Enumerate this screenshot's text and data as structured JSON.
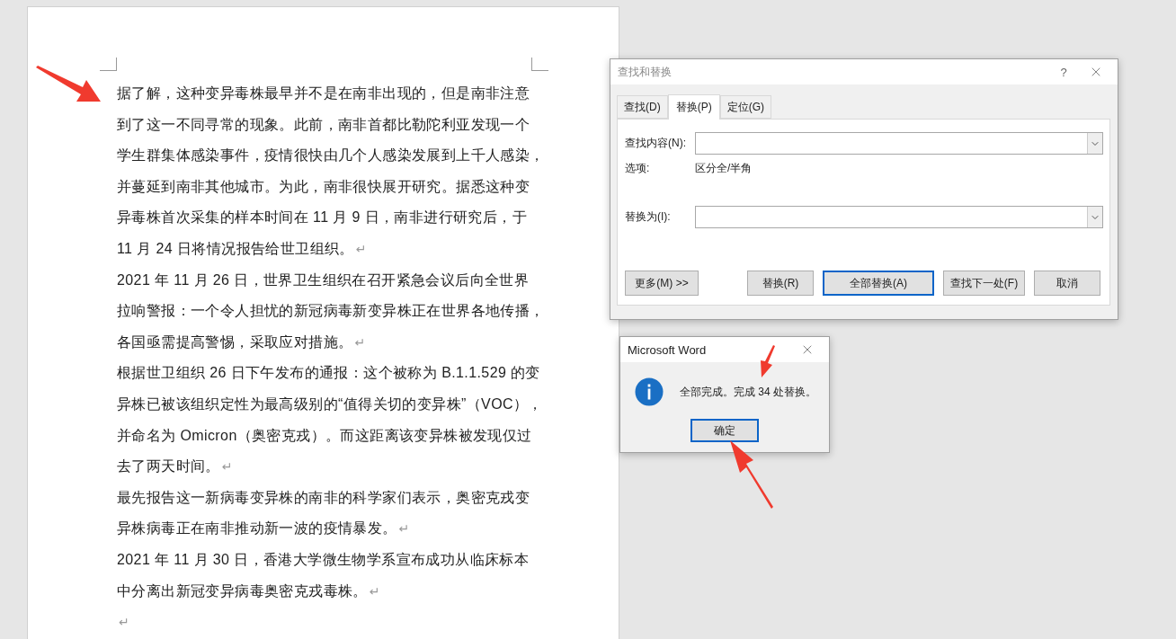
{
  "document": {
    "paragraphs": [
      {
        "lines": [
          "据了解，这种变异毒株最早并不是在南非出现的，但是南非注意",
          "到了这一不同寻常的现象。此前，南非首都比勒陀利亚发现一个",
          "学生群集体感染事件，疫情很快由几个人感染发展到上千人感染，",
          "并蔓延到南非其他城市。为此，南非很快展开研究。据悉这种变",
          "异毒株首次采集的样本时间在 11 月 9 日，南非进行研究后，于",
          "11 月 24 日将情况报告给世卫组织。"
        ],
        "mark": "↵"
      },
      {
        "lines": [
          "2021 年 11 月 26 日，世界卫生组织在召开紧急会议后向全世界",
          "拉响警报：一个令人担忧的新冠病毒新变异株正在世界各地传播，",
          "各国亟需提高警惕，采取应对措施。"
        ],
        "mark": "↵"
      },
      {
        "lines": [
          "根据世卫组织 26 日下午发布的通报：这个被称为 B.1.1.529 的变",
          "异株已被该组织定性为最高级别的“值得关切的变异株”（VOC），",
          "并命名为 Omicron（奥密克戎）。而这距离该变异株被发现仅过",
          "去了两天时间。"
        ],
        "mark": "↵"
      },
      {
        "lines": [
          "最先报告这一新病毒变异株的南非的科学家们表示，奥密克戎变",
          "异株病毒正在南非推动新一波的疫情暴发。"
        ],
        "mark": "↵"
      },
      {
        "lines": [
          "2021 年 11 月 30 日，香港大学微生物学系宣布成功从临床标本",
          "中分离出新冠变异病毒奥密克戎毒株。"
        ],
        "mark": "↵"
      },
      {
        "mark": "↵"
      }
    ]
  },
  "find_replace_dialog": {
    "title": "查找和替换",
    "help": "?",
    "tabs": [
      {
        "label": "查找(D)",
        "selected": false
      },
      {
        "label": "替换(P)",
        "selected": true
      },
      {
        "label": "定位(G)",
        "selected": false
      }
    ],
    "find_field": {
      "label": "查找内容(N):"
    },
    "options": {
      "label": "选项:",
      "value": "区分全/半角"
    },
    "replace_field": {
      "label": "替换为(I):"
    },
    "more_button": {
      "label": "更多(M) >>"
    },
    "buttons": [
      {
        "label": "替换(R)",
        "focused": false
      },
      {
        "label": "全部替换(A)",
        "focused": true
      },
      {
        "label": "查找下一处(F)",
        "focused": false
      },
      {
        "label": "取消",
        "focused": false
      }
    ]
  },
  "message_box": {
    "title": "Microsoft Word",
    "message": "全部完成。完成 34 处替换。",
    "ok_button": {
      "label": "确定",
      "focused": true
    }
  }
}
